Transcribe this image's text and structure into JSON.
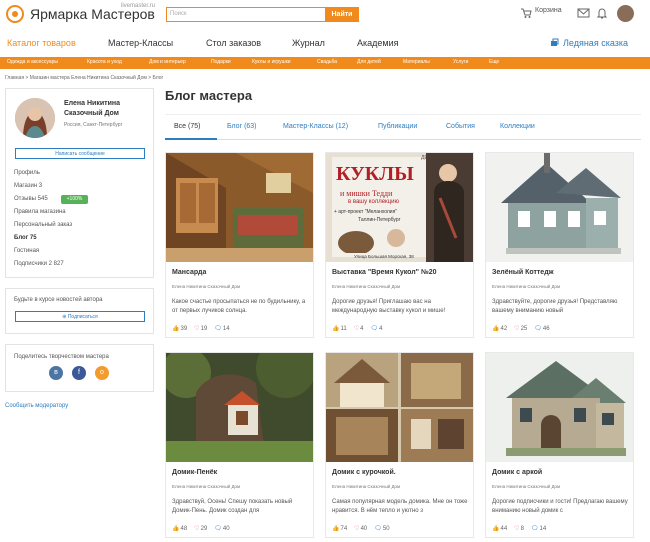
{
  "header": {
    "logo": "Ярмарка Мастеров",
    "logo_sub": "livemaster.ru",
    "search_placeholder": "Поиск",
    "search_button": "Найти",
    "cart": "Корзина",
    "icons": [
      "cart-icon",
      "mail-icon",
      "bell-icon"
    ]
  },
  "nav": {
    "items": [
      "Каталог товаров",
      "Мастер-Классы",
      "Стол заказов",
      "Журнал",
      "Академия"
    ],
    "right": "Ледяная сказка"
  },
  "categories": [
    "Одежда и аксессуары",
    "Красота и уход",
    "Дом и интерьер",
    "Подарки",
    "Куклы и игрушки",
    "Свадьба",
    "Для детей",
    "Материалы",
    "Услуги",
    "Еще"
  ],
  "breadcrumb": "Главная  >  Магазин мастера Елена Никитина Сказочный Дом  >  Блог",
  "profile": {
    "name": "Елена Никитина Сказочный Дом",
    "location": "Россия, Санкт-Петербург",
    "message_button": "Написать сообщение"
  },
  "menu": [
    "Профиль",
    "Магазин 3",
    "Отзывы 545",
    "Правила магазина",
    "Персональный заказ",
    "Блог 75",
    "Гостиная",
    "Подписчики 2 827"
  ],
  "badge": "+100%",
  "subscribe": {
    "title": "Будьте в курсе новостей автора",
    "button": "Подписаться"
  },
  "share": {
    "title": "Поделитесь творчеством мастера",
    "icons": [
      "vk-icon",
      "facebook-icon",
      "odnoklassniki-icon"
    ]
  },
  "report": "Сообщить модератору",
  "blog": {
    "title": "Блог мастера",
    "tabs": [
      "Все (75)",
      "Блог (63)",
      "Мастер-Классы (12)",
      "Публикации",
      "События",
      "Коллекции"
    ]
  },
  "posts": [
    {
      "title": "Мансарда",
      "author": "Елена Никитина Сказочный Дом",
      "text": "Какое счастье просыпаться не по будильнику, а от первых лучиков солнца.",
      "likes": "39",
      "hearts": "19",
      "comments": "14",
      "image": "attic-room"
    },
    {
      "title": "Выставка \"Время Кукол\" №20",
      "author": "Елена Никитина Сказочный Дом",
      "text": "Дорогие друзья! Приглашаю вас на международную выставку кукол и мише!",
      "likes": "11",
      "hearts": "4",
      "comments": "4",
      "image": "doll-poster",
      "poster_lines": [
        "ДЕКОРИЯ",
        "КУКЛЫ",
        "и мишки Тедди",
        "в вашу коллекцию",
        "+ арт-проект \"Меланхолия\"",
        "Таллин-Петербург",
        "Улица Большая Морская, 38"
      ]
    },
    {
      "title": "Зелёный Коттедж",
      "author": "Елена Никитина Сказочный Дом",
      "text": "Здравствуйте, дорогие друзья! Представляю вашему вниманию новый",
      "likes": "42",
      "hearts": "25",
      "comments": "46",
      "image": "green-cottage"
    },
    {
      "title": "Домик-Пенёк",
      "author": "Елена Никитина Сказочный Дом",
      "text": "Здравствуй, Осень! Спешу показать новый Домик-Пень. Домик создан для",
      "likes": "48",
      "hearts": "29",
      "comments": "40",
      "image": "stump-house"
    },
    {
      "title": "Домик с курочкой.",
      "author": "Елена Никитина Сказочный Дом",
      "text": "Самая популярная модель домика. Мне он тоже нравится. В нём тепло и уютно з",
      "likes": "74",
      "hearts": "40",
      "comments": "50",
      "image": "hen-house"
    },
    {
      "title": "Домик с аркой",
      "author": "Елена Никитина Сказочный Дом",
      "text": "Дорогие подписчики и гости! Предлагаю вашему вниманию новый домик с",
      "likes": "44",
      "hearts": "8",
      "comments": "14",
      "image": "arch-house"
    }
  ]
}
